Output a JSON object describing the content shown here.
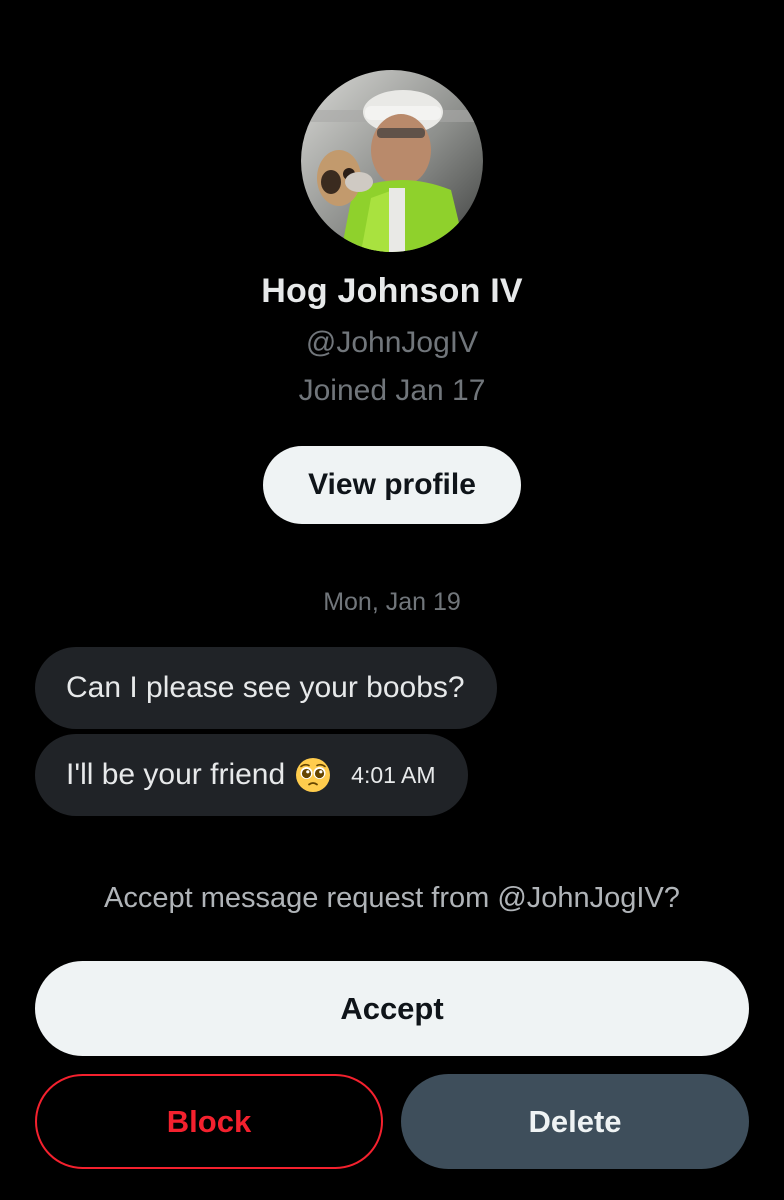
{
  "profile": {
    "avatar_icon": "user-photo-avatar",
    "display_name": "Hog Johnson IV",
    "handle": "@JohnJogIV",
    "joined": "Joined Jan 17",
    "view_profile_label": "View profile"
  },
  "conversation": {
    "date_label": "Mon, Jan 19",
    "messages": [
      {
        "text": "Can I please see your boobs?"
      },
      {
        "text": "I'll be your friend",
        "emoji": "pleading-face-emoji",
        "time": "4:01 AM"
      }
    ]
  },
  "request": {
    "prompt": "Accept message request from @JohnJogIV?",
    "accept_label": "Accept",
    "block_label": "Block",
    "delete_label": "Delete"
  },
  "colors": {
    "background": "#000000",
    "primary_text": "#e7e9ea",
    "secondary_text": "#71767b",
    "bubble": "#202327",
    "light_button": "#eff3f4",
    "block_red": "#f4212e",
    "delete_gray": "#3e4e5b"
  }
}
